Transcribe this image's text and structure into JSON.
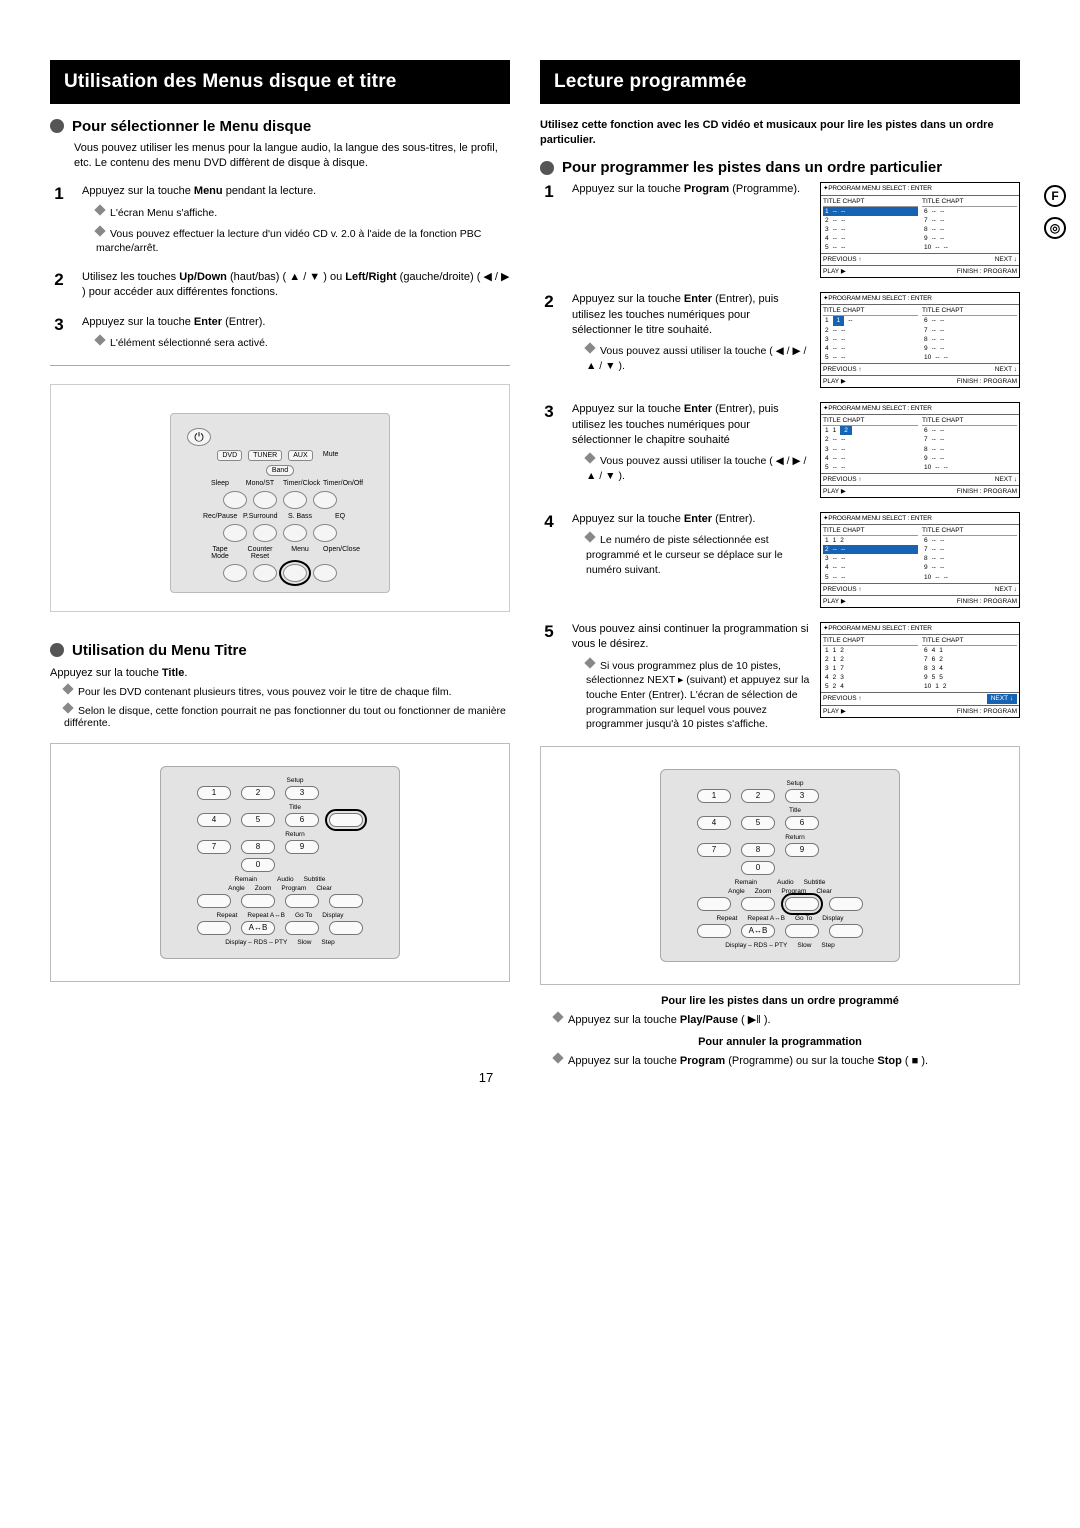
{
  "page_number": "17",
  "side_badge_top": "F",
  "side_badge_bottom": "◎",
  "left": {
    "header": "Utilisation des Menus disque et titre",
    "sec1": {
      "title": "Pour sélectionner le Menu disque",
      "intro": "Vous pouvez utiliser les menus pour la langue audio, la langue des sous-titres, le profil, etc. Le contenu des menu DVD diffèrent de disque à disque.",
      "steps": [
        {
          "main": "Appuyez sur la touche Menu pendant la lecture.",
          "bullets": [
            "L'écran Menu s'affiche.",
            "Vous pouvez effectuer la lecture d'un vidéo CD v. 2.0 à l'aide de la fonction PBC marche/arrêt."
          ]
        },
        {
          "main": "Utilisez les touches Up/Down (haut/bas) ( ▲ / ▼ ) ou Left/Right (gauche/droite) ( ◀ / ▶ ) pour accéder aux différentes fonctions."
        },
        {
          "main": "Appuyez sur la touche Enter (Entrer).",
          "bullets": [
            "L'élément sélectionné sera activé."
          ]
        }
      ]
    },
    "remote_top_labels": [
      "DVD",
      "TUNER",
      "AUX",
      "Mute",
      "Band",
      "Sleep",
      "Mono/ST",
      "Timer/Clock",
      "Timer/On/Off",
      "Rec/Pause",
      "P.Surround",
      "S. Bass",
      "EQ",
      "Tape Mode",
      "Counter Reset",
      "Menu",
      "Open/Close"
    ],
    "sec2": {
      "title": "Utilisation du Menu Titre",
      "line1": "Appuyez sur la touche Title.",
      "bullets": [
        "Pour les DVD contenant plusieurs titres, vous pouvez voir le titre de chaque film.",
        "Selon le disque, cette fonction pourrait ne pas fonctionner du tout ou fonctionner de manière différente."
      ]
    },
    "numpad_labels": {
      "side": [
        "Setup",
        "Title",
        "Return"
      ],
      "nums": [
        "1",
        "2",
        "3",
        "4",
        "5",
        "6",
        "7",
        "8",
        "9",
        "0"
      ],
      "row4": [
        "Remain",
        "Audio",
        "Subtitle"
      ],
      "row5": [
        "Angle",
        "Zoom",
        "Program",
        "Clear"
      ],
      "row6": [
        "Repeat",
        "Repeat A↔B",
        "Go To",
        "Display"
      ],
      "row7": [
        "Display – RDS – PTY",
        "Slow",
        "Step"
      ]
    }
  },
  "right": {
    "header": "Lecture programmée",
    "intro": "Utilisez cette fonction avec les CD vidéo et musicaux pour lire les pistes dans un ordre particulier.",
    "sec1_title": "Pour programmer les pistes dans un ordre particulier",
    "steps": [
      {
        "main": "Appuyez sur la touche Program (Programme)."
      },
      {
        "main": "Appuyez sur la touche Enter (Entrer), puis utilisez les touches numériques pour sélectionner le titre souhaité.",
        "bullets": [
          "Vous pouvez aussi utiliser la touche  ( ◀ / ▶ / ▲ / ▼ )."
        ]
      },
      {
        "main": "Appuyez sur la touche Enter (Entrer), puis utilisez les touches numériques pour sélectionner le chapitre souhaité",
        "bullets": [
          "Vous pouvez aussi utiliser la touche  ( ◀ / ▶ / ▲ / ▼ )."
        ]
      },
      {
        "main": "Appuyez sur la touche Enter (Entrer).",
        "bullets": [
          "Le numéro de piste sélectionnée est programmé et le curseur se déplace sur le numéro suivant."
        ]
      },
      {
        "main": "Vous pouvez ainsi continuer la programmation si vous le désirez.",
        "bullets": [
          "Si vous programmez plus de 10 pistes, sélectionnez  NEXT ▸  (suivant) et appuyez sur la touche Enter (Entrer). L'écran de sélection de programmation sur lequel vous pouvez programmer jusqu'à 10 pistes s'affiche."
        ]
      }
    ],
    "progtable_header": "✦PROGRAM MENU  SELECT : ENTER",
    "progtable_col": "TITLE CHAPT",
    "progtable_prev": "PREVIOUS ↑",
    "progtable_next": "NEXT ↓",
    "progtable_play": "PLAY  ▶",
    "progtable_finish": "FINISH : PROGRAM",
    "footer": {
      "box1": "Pour lire les pistes dans un ordre programmé",
      "line1": "Appuyez sur la touche Play/Pause ( ▶‖ ).",
      "box2": "Pour annuler la programmation",
      "line2": "Appuyez sur la touche Program (Programme) ou sur la touche Stop ( ■ )."
    }
  }
}
